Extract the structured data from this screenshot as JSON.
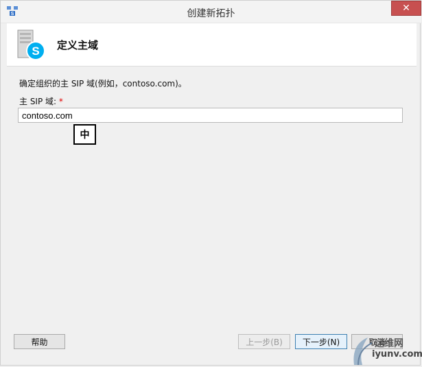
{
  "window": {
    "title": "创建新拓扑",
    "close_glyph": "✕"
  },
  "header": {
    "title": "定义主域"
  },
  "form": {
    "description": "确定组织的主 SIP 域(例如，contoso.com)。",
    "domain_label": "主 SIP 域:",
    "required_mark": "*",
    "domain_value": "contoso.com"
  },
  "ime": {
    "label": "中"
  },
  "buttons": {
    "help": "帮助",
    "back": "上一步(B)",
    "next": "下一步(N)",
    "cancel": "取消"
  },
  "watermark": {
    "line1": "运维网",
    "line2": "iyunv.com"
  },
  "colors": {
    "skype_blue": "#00aff0",
    "required": "#e00000",
    "close_red": "#c75050"
  },
  "icons": {
    "title": "topology-builder-icon",
    "header": "skype-server-icon"
  }
}
